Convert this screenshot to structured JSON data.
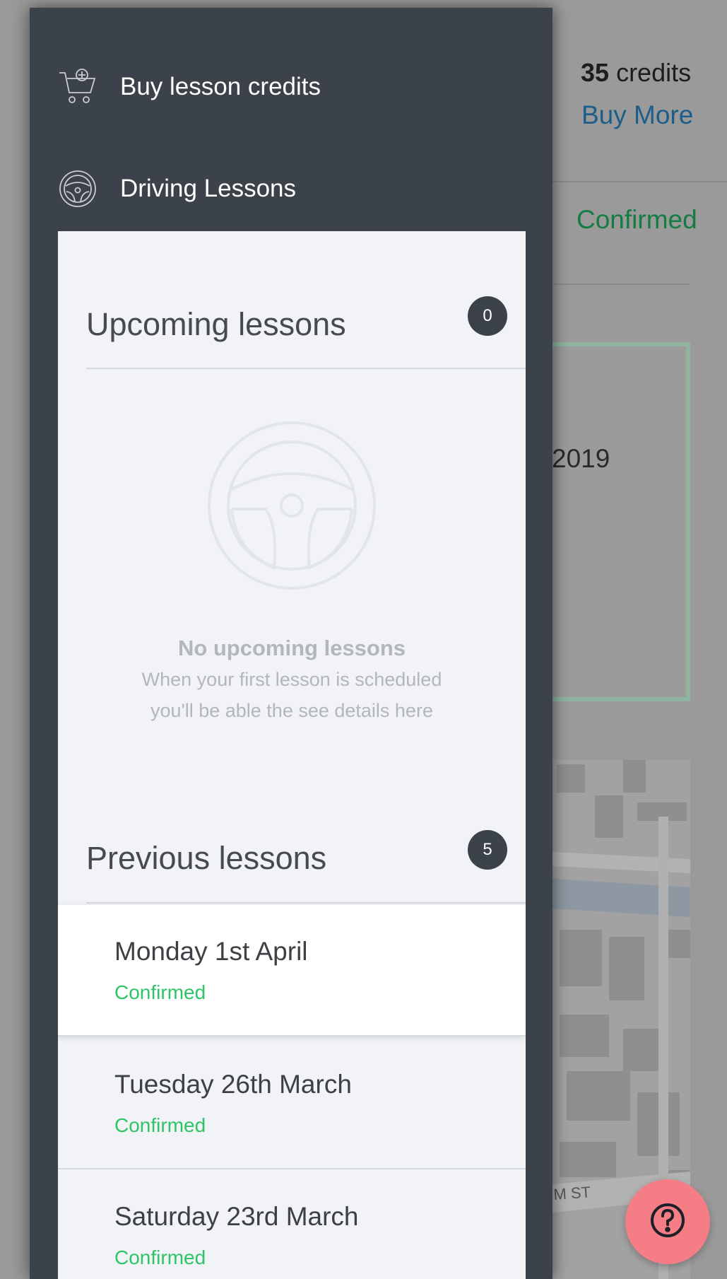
{
  "background": {
    "credits_count": "35",
    "credits_unit": "credits",
    "buy_more": "Buy More",
    "status": "Confirmed",
    "date_fragment": "2019",
    "map_street_label": "M ST"
  },
  "drawer": {
    "menu": [
      {
        "label": "Buy lesson credits",
        "icon": "cart-plus-icon"
      },
      {
        "label": "Driving Lessons",
        "icon": "steering-wheel-icon"
      }
    ],
    "upcoming": {
      "title": "Upcoming lessons",
      "count": "0",
      "empty_title": "No upcoming lessons",
      "empty_line1": "When your first lesson is scheduled",
      "empty_line2": "you'll be able the see details here",
      "empty_icon": "steering-wheel-icon"
    },
    "previous": {
      "title": "Previous lessons",
      "count": "5",
      "lessons": [
        {
          "date": "Monday 1st April",
          "status": "Confirmed"
        },
        {
          "date": "Tuesday 26th March",
          "status": "Confirmed"
        },
        {
          "date": "Saturday 23rd March",
          "status": "Confirmed"
        }
      ]
    }
  },
  "help_button": {
    "icon": "question-mark-icon"
  },
  "colors": {
    "drawer": "#3c4249",
    "panel": "#f1f3f6",
    "confirmed_green": "#2fc466",
    "help_button": "#f57e86",
    "link_blue": "#1d5d89"
  }
}
